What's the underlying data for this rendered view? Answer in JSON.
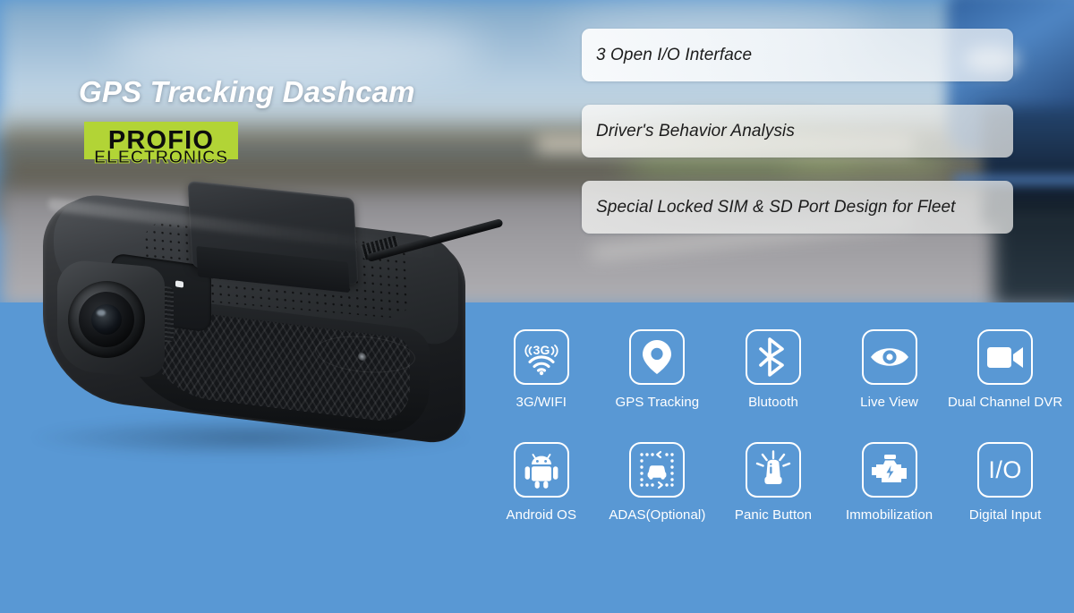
{
  "colors": {
    "panel_blue": "#5998d4",
    "logo_green": "#b2d436",
    "logo_text": "#0d0d0d",
    "pill_text": "#1c1c1c",
    "icon_white": "#ffffff"
  },
  "header": {
    "headline": "GPS Tracking Dashcam",
    "logo": {
      "word": "PROFIO",
      "sub": "ELECTRONICS"
    }
  },
  "pills": [
    {
      "text": "3 Open I/O Interface"
    },
    {
      "text": "Driver's Behavior Analysis"
    },
    {
      "text": "Special Locked SIM & SD Port Design for Fleet"
    }
  ],
  "product": {
    "name": "gps-tracking-dashcam-device"
  },
  "features": {
    "row1": [
      {
        "label": "3G/WIFI",
        "icon": "3g-wifi-signal-icon"
      },
      {
        "label": "GPS Tracking",
        "icon": "map-pin-icon"
      },
      {
        "label": "Blutooth",
        "icon": "bluetooth-icon"
      },
      {
        "label": "Live View",
        "icon": "eye-icon"
      },
      {
        "label": "Dual Channel DVR",
        "icon": "video-camera-icon"
      }
    ],
    "row2": [
      {
        "label": "Android OS",
        "icon": "android-robot-icon"
      },
      {
        "label": "ADAS(Optional)",
        "icon": "adas-car-lane-icon"
      },
      {
        "label": "Panic Button",
        "icon": "siren-beacon-icon"
      },
      {
        "label": "Immobilization",
        "icon": "engine-bolt-icon"
      },
      {
        "label": "Digital Input",
        "icon": "io-text-icon",
        "glyph": "I/O"
      }
    ]
  }
}
